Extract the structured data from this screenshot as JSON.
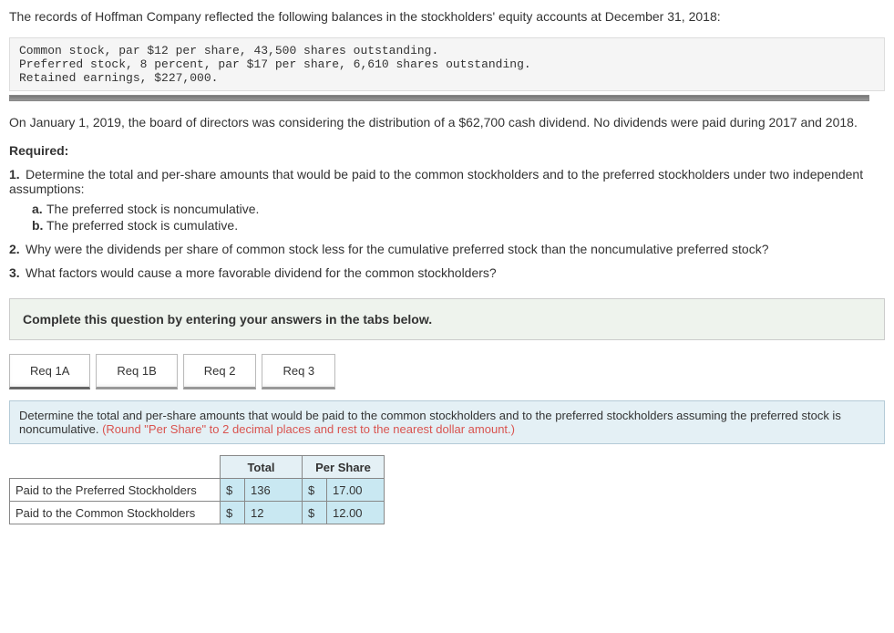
{
  "intro": "The records of Hoffman Company reflected the following balances in the stockholders' equity accounts at December 31, 2018:",
  "code": {
    "line1": "Common stock, par $12 per share, 43,500 shares outstanding.",
    "line2": "Preferred stock, 8 percent, par $17 per share, 6,610 shares outstanding.",
    "line3": "Retained earnings, $227,000."
  },
  "para2": "On January 1, 2019, the board of directors was considering the distribution of a $62,700 cash dividend. No dividends were paid during 2017 and 2018.",
  "required_label": "Required:",
  "req1": "Determine the total and per-share amounts that would be paid to the common stockholders and to the preferred stockholders under two independent assumptions:",
  "req1a": "The preferred stock is noncumulative.",
  "req1b": "The preferred stock is cumulative.",
  "req2": "Why were the dividends per share of common stock less for the cumulative preferred stock than the noncumulative preferred stock?",
  "req3": "What factors would cause a more favorable dividend for the common stockholders?",
  "answerbox_text": "Complete this question by entering your answers in the tabs below.",
  "tabs": {
    "t1": "Req 1A",
    "t2": "Req 1B",
    "t3": "Req 2",
    "t4": "Req 3"
  },
  "instruct_main": "Determine the total and per-share amounts that would be paid to the common stockholders and to the preferred stockholders assuming the preferred stock is noncumulative. ",
  "instruct_orange": "(Round \"Per Share\" to 2 decimal places and rest to the nearest dollar amount.)",
  "table": {
    "h_total": "Total",
    "h_pershare": "Per Share",
    "row1_label": "Paid to the Preferred Stockholders",
    "row2_label": "Paid to the Common Stockholders",
    "dollar": "$",
    "r1_total": "136",
    "r1_ps": "17.00",
    "r2_total": "12",
    "r2_ps": "12.00"
  }
}
